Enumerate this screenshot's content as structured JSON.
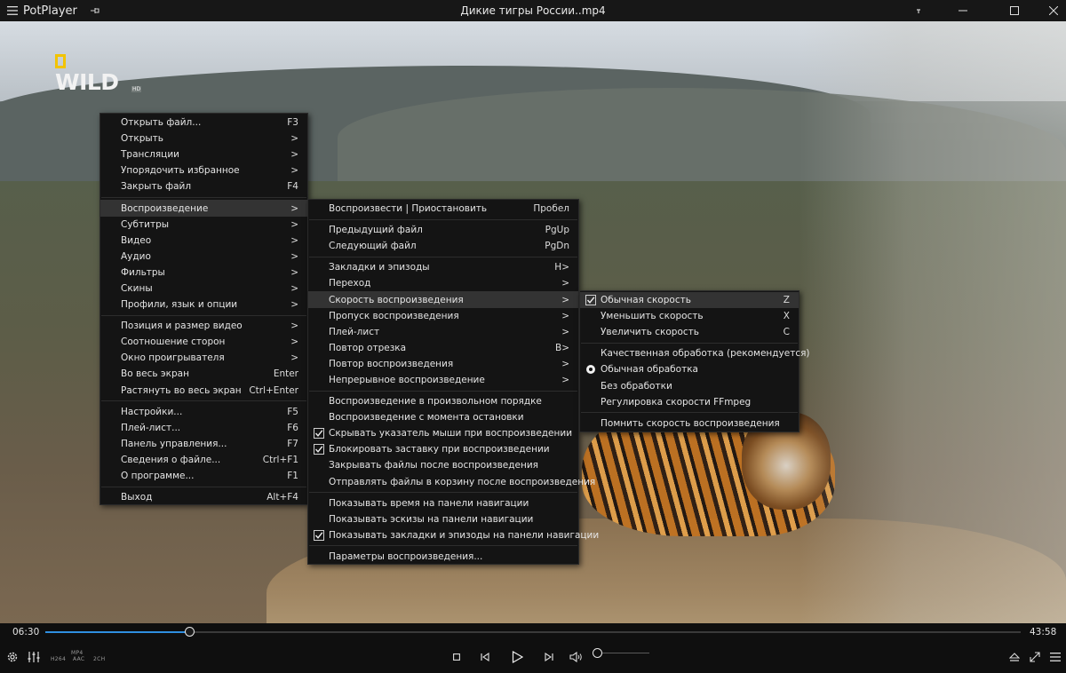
{
  "window": {
    "app_name": "PotPlayer",
    "title": "Дикие тигры России..mp4"
  },
  "video": {
    "logo_text": "WILD",
    "logo_hd": "HD"
  },
  "main_menu": {
    "groups": [
      [
        {
          "label": "Открыть файл...",
          "shortcut": "F3"
        },
        {
          "label": "Открыть",
          "shortcut": ">"
        },
        {
          "label": "Трансляции",
          "shortcut": ">"
        },
        {
          "label": "Упорядочить избранное",
          "shortcut": ">"
        },
        {
          "label": "Закрыть файл",
          "shortcut": "F4"
        }
      ],
      [
        {
          "label": "Воспроизведение",
          "shortcut": ">",
          "highlighted": true
        },
        {
          "label": "Субтитры",
          "shortcut": ">"
        },
        {
          "label": "Видео",
          "shortcut": ">"
        },
        {
          "label": "Аудио",
          "shortcut": ">"
        },
        {
          "label": "Фильтры",
          "shortcut": ">"
        },
        {
          "label": "Скины",
          "shortcut": ">"
        },
        {
          "label": "Профили, язык и опции",
          "shortcut": ">"
        }
      ],
      [
        {
          "label": "Позиция и размер видео",
          "shortcut": ">"
        },
        {
          "label": "Соотношение сторон",
          "shortcut": ">"
        },
        {
          "label": "Окно проигрывателя",
          "shortcut": ">"
        },
        {
          "label": "Во весь экран",
          "shortcut": "Enter"
        },
        {
          "label": "Растянуть во весь экран",
          "shortcut": "Ctrl+Enter"
        }
      ],
      [
        {
          "label": "Настройки...",
          "shortcut": "F5"
        },
        {
          "label": "Плей-лист...",
          "shortcut": "F6"
        },
        {
          "label": "Панель управления...",
          "shortcut": "F7"
        },
        {
          "label": "Сведения о файле...",
          "shortcut": "Ctrl+F1"
        },
        {
          "label": "О программе...",
          "shortcut": "F1"
        }
      ],
      [
        {
          "label": "Выход",
          "shortcut": "Alt+F4"
        }
      ]
    ]
  },
  "playback_menu": {
    "groups": [
      [
        {
          "label": "Воспроизвести | Приостановить",
          "shortcut": "Пробел"
        }
      ],
      [
        {
          "label": "Предыдущий файл",
          "shortcut": "PgUp"
        },
        {
          "label": "Следующий файл",
          "shortcut": "PgDn"
        }
      ],
      [
        {
          "label": "Закладки и эпизоды",
          "shortcut": "H>"
        },
        {
          "label": "Переход",
          "shortcut": ">"
        },
        {
          "label": "Скорость воспроизведения",
          "shortcut": ">",
          "highlighted": true
        },
        {
          "label": "Пропуск воспроизведения",
          "shortcut": ">"
        },
        {
          "label": "Плей-лист",
          "shortcut": ">"
        },
        {
          "label": "Повтор отрезка",
          "shortcut": "B>"
        },
        {
          "label": "Повтор воспроизведения",
          "shortcut": ">"
        },
        {
          "label": "Непрерывное воспроизведение",
          "shortcut": ">"
        }
      ],
      [
        {
          "label": "Воспроизведение в произвольном порядке",
          "shortcut": ""
        },
        {
          "label": "Воспроизведение с момента остановки",
          "shortcut": ""
        },
        {
          "label": "Скрывать указатель мыши при воспроизведении",
          "shortcut": "",
          "checked": true
        },
        {
          "label": "Блокировать заставку при воспроизведении",
          "shortcut": "",
          "checked": true
        },
        {
          "label": "Закрывать файлы после воспроизведения",
          "shortcut": ""
        },
        {
          "label": "Отправлять файлы в корзину после воспроизведения",
          "shortcut": ""
        }
      ],
      [
        {
          "label": "Показывать время на панели навигации",
          "shortcut": ""
        },
        {
          "label": "Показывать эскизы на панели навигации",
          "shortcut": ""
        },
        {
          "label": "Показывать закладки и эпизоды на панели навигации",
          "shortcut": "",
          "checked": true
        }
      ],
      [
        {
          "label": "Параметры воспроизведения...",
          "shortcut": ""
        }
      ]
    ]
  },
  "speed_menu": {
    "groups": [
      [
        {
          "label": "Обычная скорость",
          "shortcut": "Z",
          "checked": true,
          "highlighted": true
        },
        {
          "label": "Уменьшить скорость",
          "shortcut": "X"
        },
        {
          "label": "Увеличить скорость",
          "shortcut": "C"
        }
      ],
      [
        {
          "label": "Качественная обработка (рекомендуется)",
          "shortcut": ""
        },
        {
          "label": "Обычная обработка",
          "shortcut": "",
          "radio": true
        },
        {
          "label": "Без обработки",
          "shortcut": ""
        },
        {
          "label": "Регулировка скорости FFmpeg",
          "shortcut": ""
        }
      ],
      [
        {
          "label": "Помнить скорость воспроизведения",
          "shortcut": ""
        }
      ]
    ]
  },
  "seek": {
    "current_time": "06:30",
    "total_time": "43:58",
    "progress": 0.1478
  },
  "controls": {
    "badges": {
      "video_codec": "H264",
      "container": "MP4",
      "audio_codec": "AAC",
      "channels": "2CH"
    },
    "volume": 0.0,
    "icons": [
      "settings-icon",
      "equalizer-icon",
      "stop-icon",
      "previous-icon",
      "play-icon",
      "next-icon",
      "volume-icon",
      "eject-icon",
      "fullscreen-icon",
      "menu-icon"
    ]
  }
}
